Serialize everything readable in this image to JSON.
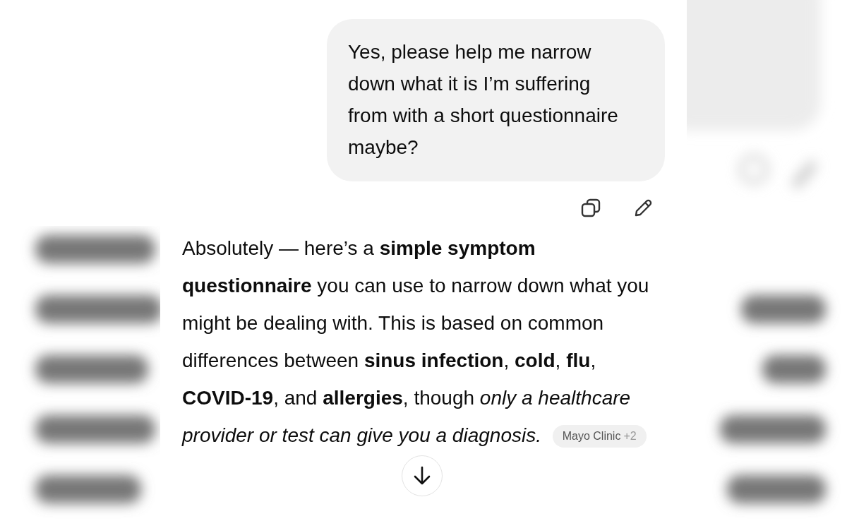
{
  "user_message": {
    "text": "Yes, please help me narrow down what it is I’m suffering from with a short questionnaire maybe?"
  },
  "message_actions": [
    {
      "kind": "copy"
    },
    {
      "kind": "edit"
    }
  ],
  "assistant_message": {
    "text": "Absolutely — here’s a **simple symptom questionnaire** you can use to narrow down what you might be dealing with. This is based on common differences between **sinus infection**, **cold**, **flu**, **COVID-19**, and **allergies**, though *only a healthcare provider or test can give you a diagnosis.*",
    "source_chip": {
      "label": "Mayo Clinic",
      "count": "+2"
    }
  }
}
